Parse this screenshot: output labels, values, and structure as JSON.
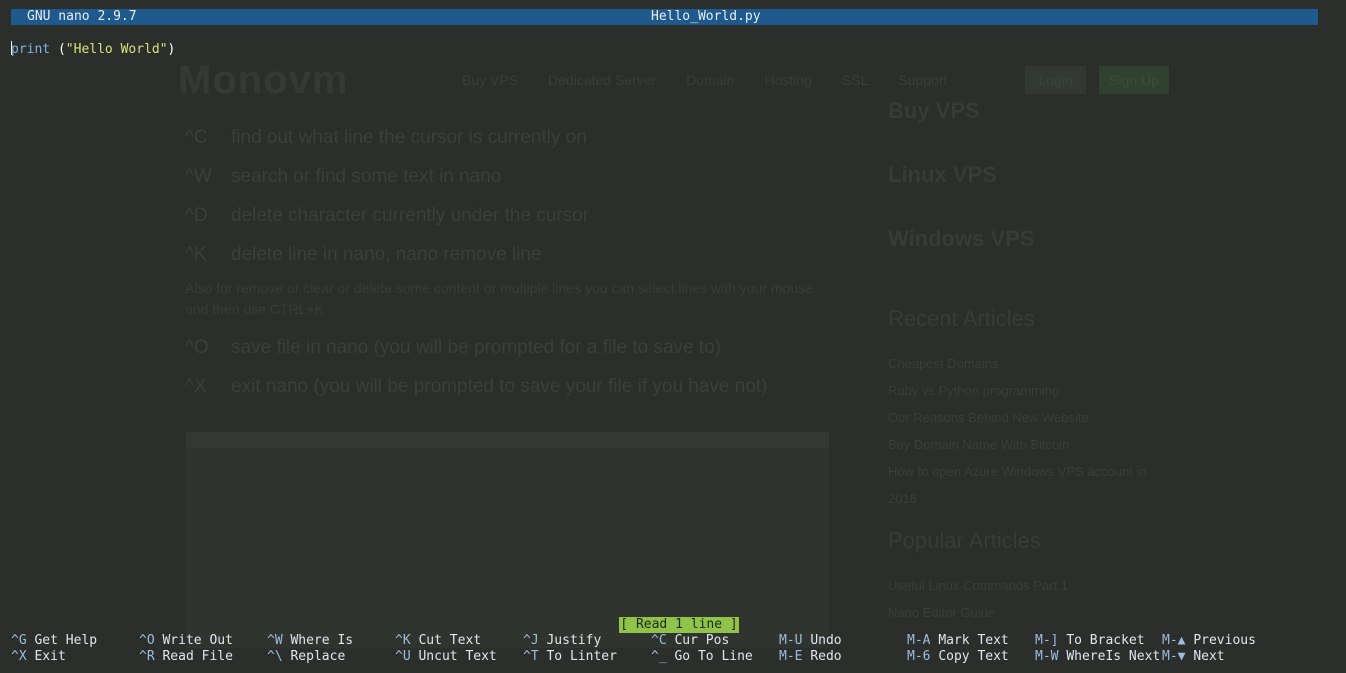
{
  "titlebar": {
    "app_version": "GNU nano 2.9.7",
    "filename": "Hello_World.py"
  },
  "editor": {
    "line1_keyword": "print",
    "line1_space": " (",
    "line1_string": "\"Hello World\"",
    "line1_close": ")"
  },
  "status": {
    "message": "[ Read 1 line ]"
  },
  "shortcuts": {
    "row1": [
      {
        "key": "^G",
        "label": "Get Help"
      },
      {
        "key": "^O",
        "label": "Write Out"
      },
      {
        "key": "^W",
        "label": "Where Is"
      },
      {
        "key": "^K",
        "label": "Cut Text"
      },
      {
        "key": "^J",
        "label": "Justify"
      },
      {
        "key": "^C",
        "label": "Cur Pos"
      },
      {
        "key": "M-U",
        "label": "Undo"
      },
      {
        "key": "M-A",
        "label": "Mark Text"
      },
      {
        "key": "M-]",
        "label": "To Bracket"
      },
      {
        "key": "M-▲",
        "label": "Previous"
      }
    ],
    "row2": [
      {
        "key": "^X",
        "label": "Exit"
      },
      {
        "key": "^R",
        "label": "Read File"
      },
      {
        "key": "^\\",
        "label": "Replace"
      },
      {
        "key": "^U",
        "label": "Uncut Text"
      },
      {
        "key": "^T",
        "label": "To Linter"
      },
      {
        "key": "^_",
        "label": "Go To Line"
      },
      {
        "key": "M-E",
        "label": "Redo"
      },
      {
        "key": "M-6",
        "label": "Copy Text"
      },
      {
        "key": "M-W",
        "label": "WhereIs Next"
      },
      {
        "key": "M-▼",
        "label": "Next"
      }
    ]
  },
  "background_site": {
    "logo": "Monovm",
    "nav": [
      "Buy VPS",
      "Dedicated Server",
      "Domain",
      "Hosting",
      "SSL",
      "Support"
    ],
    "login": "Login",
    "signup": "Sign Up",
    "rows": [
      {
        "key": "^C",
        "text": "find out what line the cursor is currently on"
      },
      {
        "key": "^W",
        "text": "search or find some text in nano"
      },
      {
        "key": "^D",
        "text": "delete character currently under the cursor"
      },
      {
        "key": "^K",
        "text": "delete line in nano, nano remove line"
      }
    ],
    "para": "Also for remove or clear or delete some content or multiple lines you can select lines with your mouse and then use CTRL+K",
    "rows2": [
      {
        "key": "^O",
        "text": "save file in nano (you will be prompted for a file to save to)"
      },
      {
        "key": "^X",
        "text": "exit nano (you will be prompted to save your file if you have not)"
      }
    ],
    "right_links_top": [
      "Buy VPS",
      "Linux VPS",
      "Windows VPS"
    ],
    "recent_title": "Recent Articles",
    "recent": [
      "Cheapest Domains",
      "Ruby vs Python programming",
      "Our Reasons Behind New Website",
      "Buy Domain Name With Bitcoin",
      "How to open Azure Windows VPS account in 2018"
    ],
    "popular_title": "Popular Articles",
    "popular": [
      "Useful Linux Commands Part 1",
      "Nano Editor Guide"
    ]
  },
  "colors": {
    "titlebar_bg": "#1f5a8e",
    "status_bg": "#8fc34a",
    "terminal_bg": "#2b2e2b"
  }
}
